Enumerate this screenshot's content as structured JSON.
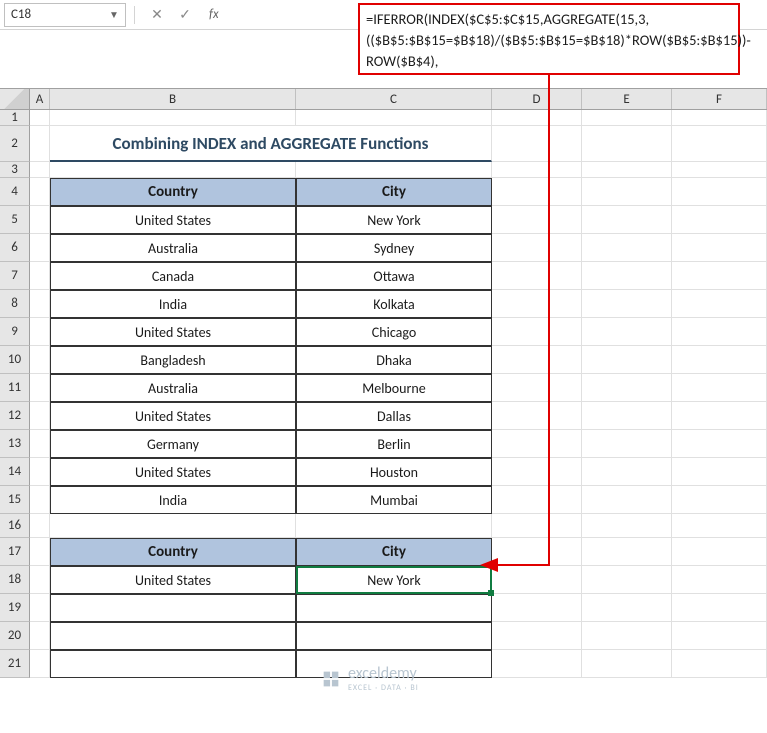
{
  "nameBox": "C18",
  "formula": "=IFERROR(INDEX($C$5:$C$15,AGGREGATE(15,3,(($B$5:$B$15=$B$18)/($B$5:$B$15=$B$18)*ROW($B$5:$B$15))-ROW($B$4),",
  "colHeaders": [
    "A",
    "B",
    "C",
    "D",
    "E",
    "F"
  ],
  "rowHeaders": [
    "1",
    "2",
    "3",
    "4",
    "5",
    "6",
    "7",
    "8",
    "9",
    "10",
    "11",
    "12",
    "13",
    "14",
    "15",
    "16",
    "17",
    "18",
    "19",
    "20",
    "21"
  ],
  "title": "Combining INDEX and AGGREGATE Functions",
  "table1": {
    "headers": {
      "country": "Country",
      "city": "City"
    },
    "rows": [
      {
        "country": "United States",
        "city": "New York"
      },
      {
        "country": "Australia",
        "city": "Sydney"
      },
      {
        "country": "Canada",
        "city": "Ottawa"
      },
      {
        "country": "India",
        "city": "Kolkata"
      },
      {
        "country": "United States",
        "city": "Chicago"
      },
      {
        "country": "Bangladesh",
        "city": "Dhaka"
      },
      {
        "country": "Australia",
        "city": "Melbourne"
      },
      {
        "country": "United States",
        "city": "Dallas"
      },
      {
        "country": "Germany",
        "city": "Berlin"
      },
      {
        "country": "United States",
        "city": "Houston"
      },
      {
        "country": "India",
        "city": "Mumbai"
      }
    ]
  },
  "table2": {
    "headers": {
      "country": "Country",
      "city": "City"
    },
    "row": {
      "country": "United States",
      "city": "New York"
    }
  },
  "watermark": {
    "main": "exceldemy",
    "sub": "EXCEL · DATA · BI"
  }
}
